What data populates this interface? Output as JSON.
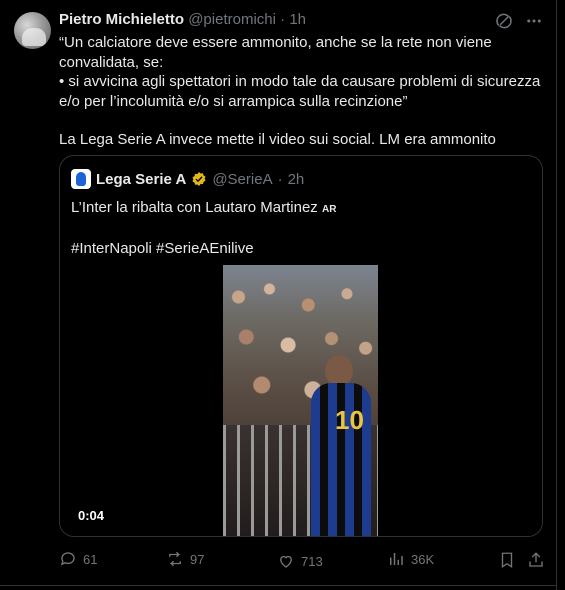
{
  "tweet": {
    "author_name": "Pietro Michieletto",
    "author_handle": "@pietromichi",
    "separator": " · ",
    "time": "1h",
    "lines": [
      "“Un calciatore deve essere ammonito, anche se la rete non viene",
      "convalidata, se:",
      "• si avvicina agli spettatori in modo tale da causare problemi di sicurezza",
      "e/o per l’incolumità e/o si arrampica sulla recinzione”"
    ],
    "line_after": "La Lega Serie A invece mette il video sui social. LM era ammonito"
  },
  "quoted": {
    "author_name": "Lega Serie A",
    "author_handle": "@SerieA",
    "separator": " · ",
    "time": "2h",
    "text": "L’Inter la ribalta con Lautaro Martinez",
    "text_badge": "AR",
    "hashtags": "#InterNapoli #SerieAEnilive",
    "video_time": "0:04"
  },
  "actions": {
    "replies": "61",
    "reposts": "97",
    "likes": "713",
    "views": "36K"
  },
  "icons": {
    "top": [
      "grok-icon",
      "more-icon"
    ],
    "actions": [
      "reply-icon",
      "repost-icon",
      "like-icon",
      "views-icon",
      "bookmark-icon",
      "share-icon"
    ]
  },
  "colors": {
    "background": "#000000",
    "text": "#e7e9ea",
    "muted": "#71767b",
    "border": "#2f3336",
    "verified_gold": "#e2b719"
  }
}
